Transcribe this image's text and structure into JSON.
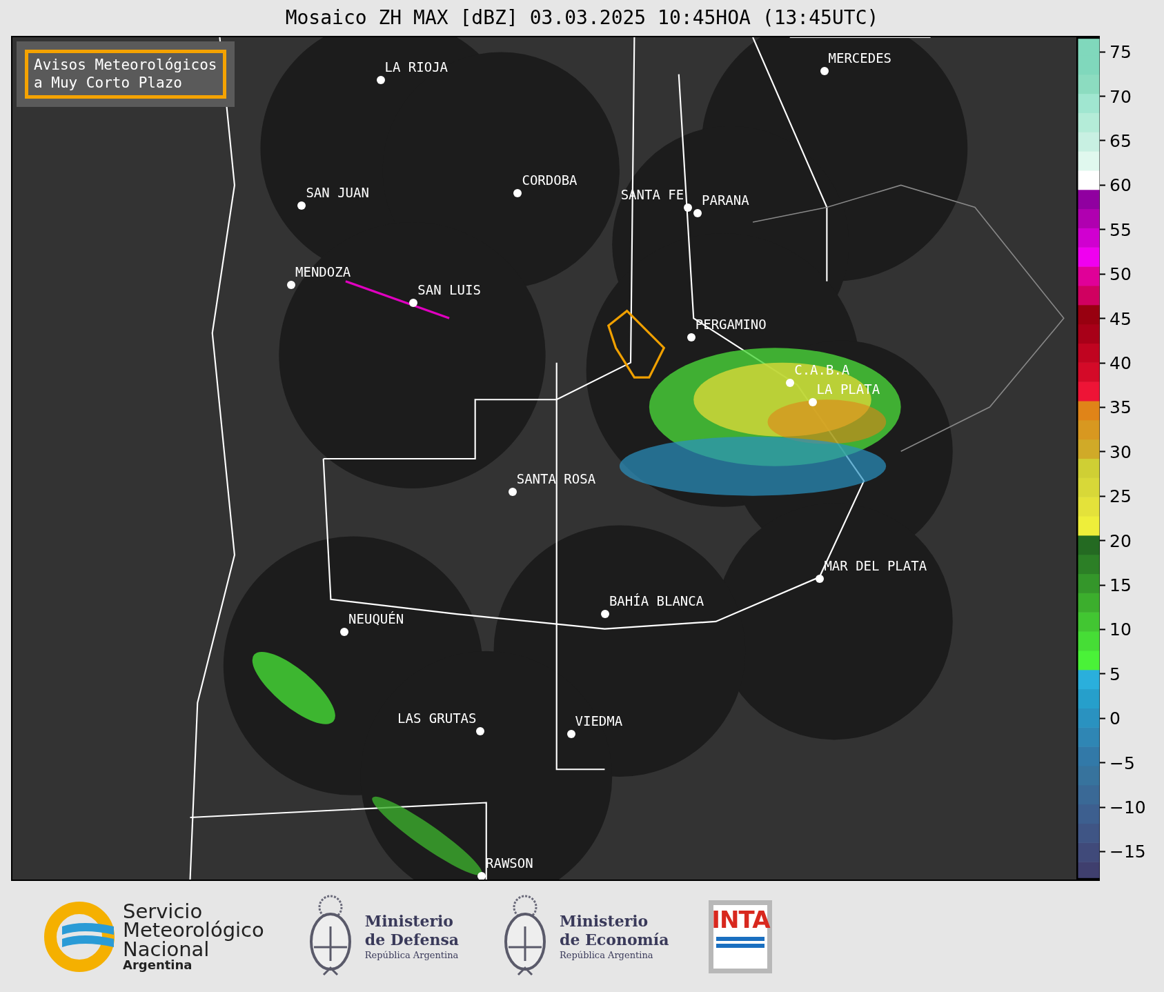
{
  "title": "Mosaico ZH MAX [dBZ] 03.03.2025 10:45HOA (13:45UTC)",
  "legend_box": {
    "lines": [
      "Avisos Meteorológicos",
      "a Muy Corto Plazo"
    ]
  },
  "cities": [
    {
      "name": "LA RIOJA"
    },
    {
      "name": "SAN JUAN"
    },
    {
      "name": "CORDOBA"
    },
    {
      "name": "SANTA FE"
    },
    {
      "name": "PARANA"
    },
    {
      "name": "MERCEDES"
    },
    {
      "name": "MENDOZA"
    },
    {
      "name": "SAN LUIS"
    },
    {
      "name": "PERGAMINO"
    },
    {
      "name": "C.A.B.A"
    },
    {
      "name": "LA PLATA"
    },
    {
      "name": "SANTA ROSA"
    },
    {
      "name": "MAR DEL PLATA"
    },
    {
      "name": "BAHÍA BLANCA"
    },
    {
      "name": "NEUQUÉN"
    },
    {
      "name": "LAS GRUTAS"
    },
    {
      "name": "VIEDMA"
    },
    {
      "name": "RAWSON"
    }
  ],
  "colorbar": {
    "ticks": [
      "75",
      "70",
      "65",
      "60",
      "55",
      "50",
      "45",
      "40",
      "35",
      "30",
      "25",
      "20",
      "15",
      "10",
      "5",
      "0",
      "−5",
      "−10",
      "−15"
    ]
  },
  "logos": [
    {
      "kind": "smn",
      "lines": [
        "Servicio",
        "Meteorológico",
        "Nacional",
        "Argentina"
      ]
    },
    {
      "kind": "ministry",
      "lines": [
        "Ministerio",
        "de Defensa",
        "República Argentina"
      ]
    },
    {
      "kind": "ministry",
      "lines": [
        "Ministerio",
        "de Economía",
        "República Argentina"
      ]
    },
    {
      "kind": "inta",
      "lines": [
        "INTA"
      ]
    }
  ]
}
